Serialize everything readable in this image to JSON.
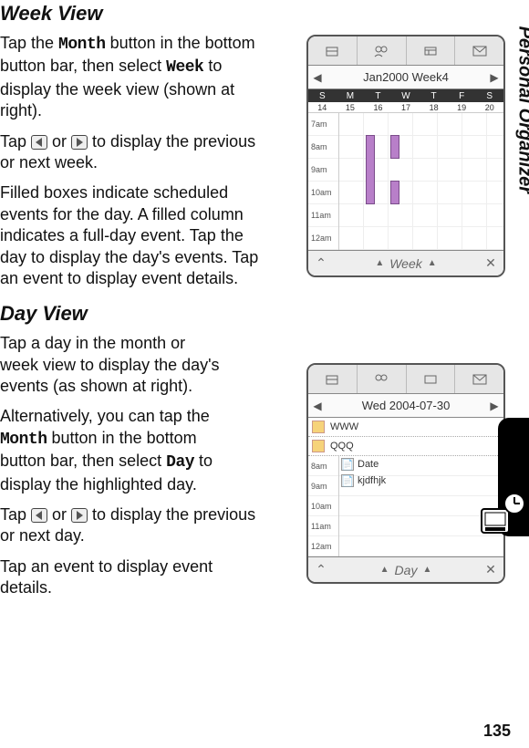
{
  "sections": {
    "week_heading": "Week View",
    "day_heading": "Day View"
  },
  "week_paras": {
    "p1a": "Tap the ",
    "p1_month": "Month",
    "p1b": " button in the bottom button bar, then select ",
    "p1_week": "Week",
    "p1c": " to display the week view (shown at right).",
    "p2a": "Tap ",
    "p2b": " or ",
    "p2c": " to display the previous or next week.",
    "p3": "Filled boxes indicate scheduled events for the day. A filled column indicates a full-day event. Tap the day to display the day's events. Tap an event to display event details."
  },
  "day_paras": {
    "p1": "Tap a day in the month or week view to display the day's events (as shown at right).",
    "p2a": "Alternatively, you can tap the ",
    "p2_month": "Month",
    "p2b": " button in the bottom button bar, then select ",
    "p2_day": "Day",
    "p2c": " to display the highlighted day.",
    "p3a": "Tap ",
    "p3b": " or ",
    "p3c": " to display the previous or next day.",
    "p4": "Tap an event to display event details."
  },
  "week_device": {
    "nav_left": "◀",
    "nav_right": "▶",
    "nav_label": "Jan2000    Week4",
    "dow": [
      "S",
      "M",
      "T",
      "W",
      "T",
      "F",
      "S"
    ],
    "dates": [
      "14",
      "15",
      "16",
      "17",
      "18",
      "19",
      "20"
    ],
    "hours": [
      "7am",
      "8am",
      "9am",
      "10am",
      "11am",
      "12am"
    ],
    "footer_label": "Week",
    "footer_up": "▲",
    "footer_close": "✕",
    "footer_double_up": "⌃"
  },
  "day_device": {
    "nav_left": "◀",
    "nav_right": "▶",
    "nav_label": "Wed    2004-07-30",
    "entries": [
      "WWW",
      "QQQ"
    ],
    "hours": [
      "8am",
      "9am",
      "10am",
      "11am",
      "12am"
    ],
    "inline1": "Date",
    "inline2": "kjdfhjk",
    "footer_label": "Day",
    "footer_up": "▲",
    "footer_close": "✕",
    "footer_double_up": "⌃"
  },
  "sidebar_label": "Personal Organizer",
  "page_number": "135"
}
